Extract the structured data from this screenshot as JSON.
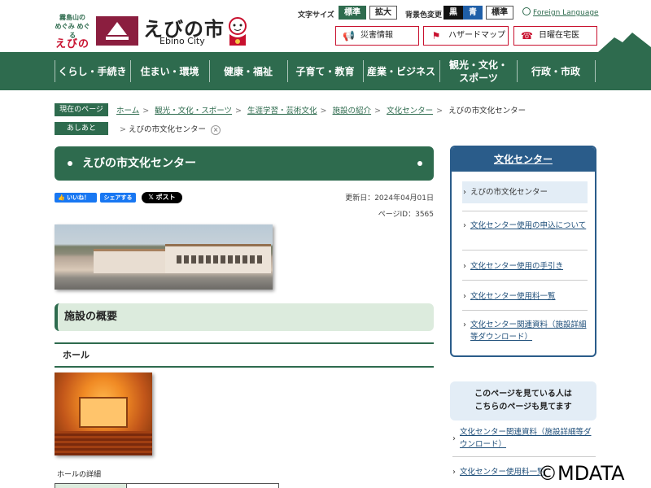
{
  "header": {
    "logo_line1": "霧島山の",
    "logo_line2": "めぐみ めぐる",
    "logo_line3": "えびの",
    "title": "えびの市",
    "subtitle": "Ebino City",
    "text_size_label": "文字サイズ",
    "text_size_standard": "標準",
    "text_size_large": "拡大",
    "bg_color_label": "背景色変更",
    "bg_black": "黒",
    "bg_blue": "青",
    "bg_standard": "標準",
    "language": "Foreign Language",
    "quick": [
      "災害情報",
      "ハザードマップ",
      "日曜在宅医"
    ]
  },
  "nav": [
    "くらし・手続き",
    "住まい・環境",
    "健康・福祉",
    "子育て・教育",
    "産業・ビジネス",
    "観光・文化・スポーツ",
    "行政・市政"
  ],
  "breadcrumb": {
    "current_label": "現在のページ",
    "links": [
      "ホーム",
      "観光・文化・スポーツ",
      "生涯学習・芸術文化",
      "施設の紹介",
      "文化センター"
    ],
    "current": "えびの市文化センター",
    "history_label": "あしあと",
    "history_item": "えびの市文化センター"
  },
  "page": {
    "title": "えびの市文化センター",
    "like": "いいね！",
    "share": "シェアする",
    "post": "ポスト",
    "updated": "更新日：2024年04月01日",
    "page_id": "ページID：3565",
    "section_title": "施設の概要",
    "sub_title": "ホール",
    "hall_detail": "ホールの詳細"
  },
  "sidebar": {
    "heading": "文化センター",
    "items": [
      "えびの市文化センター",
      "文化センター使用の申込について",
      "文化センター使用の手引き",
      "文化センター使用料一覧",
      "文化センター関連資料（施設詳細等ダウンロード）"
    ],
    "viewed_line1": "このページを見ている人は",
    "viewed_line2": "こちらのページも見てます",
    "related": [
      "文化センター関連資料（施設詳細等ダウンロード）",
      "文化センター使用料一覧"
    ]
  },
  "watermark": "©MDATA",
  "colors": {
    "primary": "#2e6b4e",
    "sidebar": "#2a5c8a",
    "accent": "#c8102e"
  }
}
